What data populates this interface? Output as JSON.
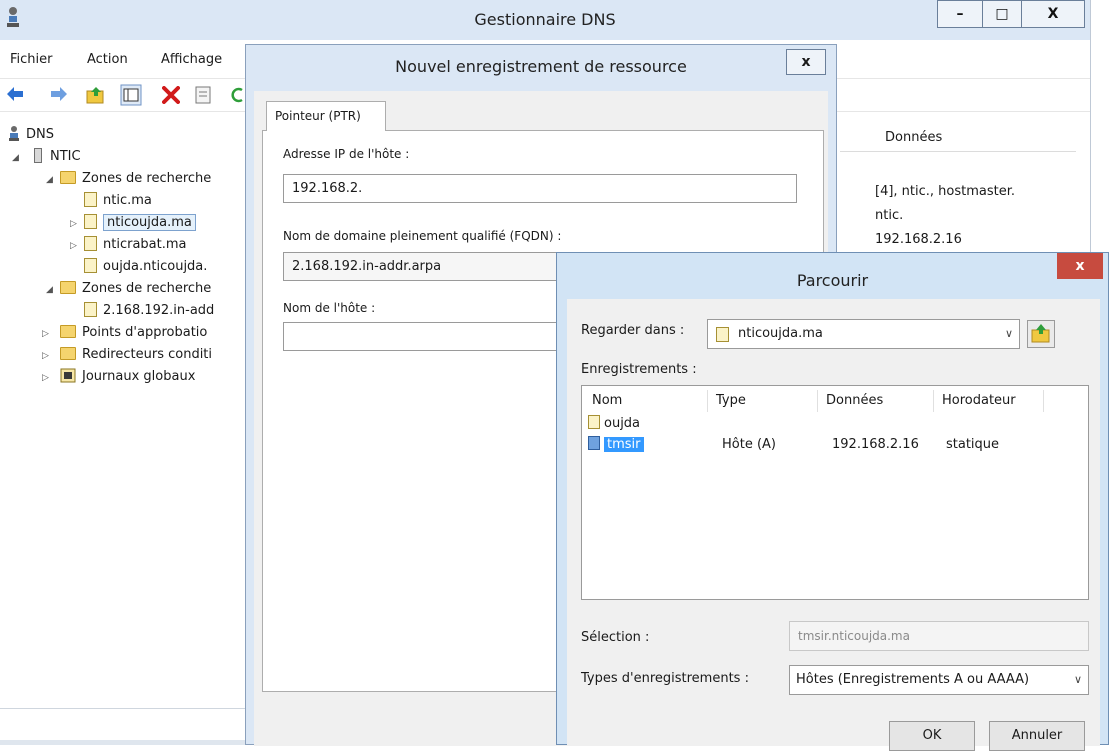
{
  "main_window": {
    "title": "Gestionnaire DNS",
    "minimize": "–",
    "maximize": "□",
    "close": "X",
    "menu": [
      "Fichier",
      "Action",
      "Affichage"
    ],
    "tree": {
      "root": "DNS",
      "server": "NTIC",
      "forward_zones": "Zones de recherche",
      "zones": [
        "ntic.ma",
        "nticoujda.ma",
        "nticrabat.ma",
        "oujda.nticoujda."
      ],
      "reverse_zones": "Zones de recherche",
      "reverse_zone_items": [
        "2.168.192.in-add"
      ],
      "trust_points": "Points d'approbatio",
      "conditional_forwarders": "Redirecteurs conditi",
      "global_logs": "Journaux globaux"
    },
    "list": {
      "header": "Données",
      "values": [
        "[4], ntic., hostmaster.",
        "ntic.",
        "192.168.2.16"
      ]
    }
  },
  "new_record_dialog": {
    "title": "Nouvel enregistrement de ressource",
    "close": "x",
    "tab": "Pointeur (PTR)",
    "host_ip_label": "Adresse IP de l'hôte :",
    "host_ip_value": "192.168.2.",
    "fqdn_label": "Nom de domaine pleinement qualifié (FQDN) :",
    "fqdn_value": "2.168.192.in-addr.arpa",
    "host_name_label": "Nom de l'hôte :",
    "host_name_value": ""
  },
  "browse_dialog": {
    "title": "Parcourir",
    "close": "x",
    "look_in_label": "Regarder dans :",
    "look_in_value": "nticoujda.ma",
    "records_label": "Enregistrements :",
    "columns": [
      "Nom",
      "Type",
      "Données",
      "Horodateur"
    ],
    "rows": [
      {
        "name": "oujda",
        "type": "",
        "data": "",
        "timestamp": ""
      },
      {
        "name": "tmsir",
        "type": "Hôte (A)",
        "data": "192.168.2.16",
        "timestamp": "statique"
      }
    ],
    "selection_label": "Sélection :",
    "selection_value": "tmsir.nticoujda.ma",
    "record_types_label": "Types d'enregistrements :",
    "record_types_value": "Hôtes (Enregistrements A ou AAAA)",
    "ok": "OK",
    "cancel": "Annuler"
  }
}
